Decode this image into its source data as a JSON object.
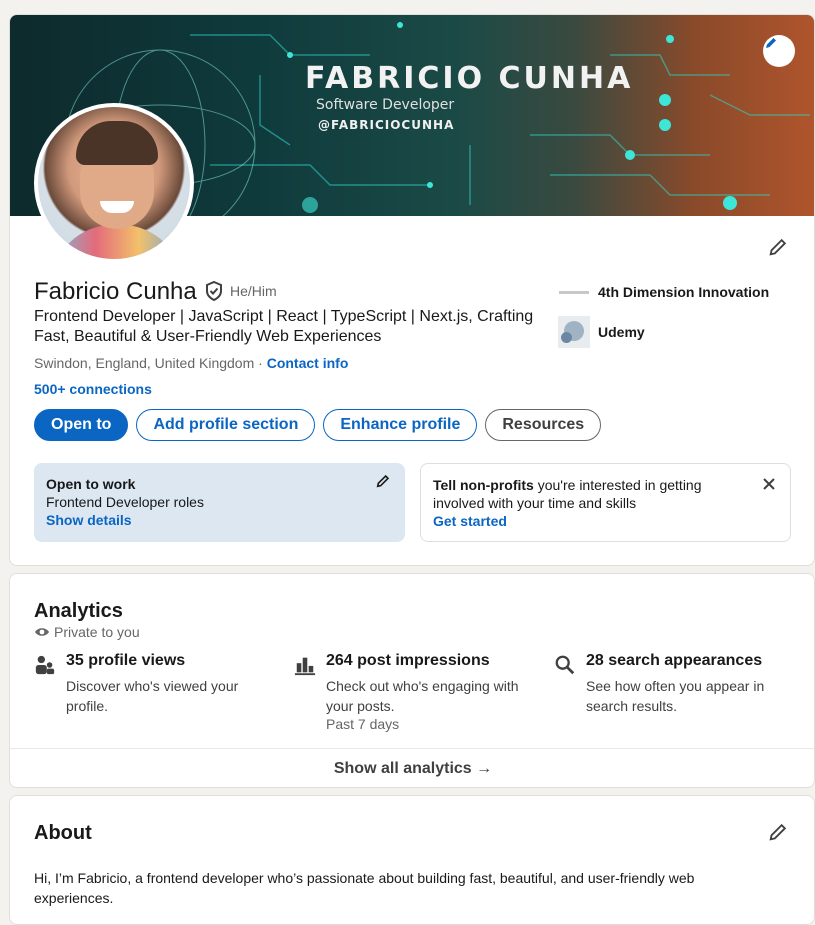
{
  "banner": {
    "title": "FABRICIO CUNHA",
    "subtitle": "Software Developer",
    "handle": "@FABRICIOCUNHA"
  },
  "profile": {
    "name": "Fabricio Cunha",
    "pronouns": "He/Him",
    "headline": "Frontend Developer | JavaScript | React | TypeScript | Next.js, Crafting Fast, Beautiful & User-Friendly Web Experiences",
    "location": "Swindon, England, United Kingdom",
    "separator": " · ",
    "contact_info": "Contact info",
    "connections": "500+ connections",
    "companies": [
      {
        "name": "4th Dimension Innovation"
      },
      {
        "name": "Udemy"
      }
    ]
  },
  "actions": {
    "open_to": "Open to",
    "add_section": "Add profile section",
    "enhance": "Enhance profile",
    "resources": "Resources"
  },
  "open_to_work": {
    "title": "Open to work",
    "roles": "Frontend Developer roles",
    "link": "Show details"
  },
  "non_profits": {
    "bold": "Tell non-profits",
    "text": " you're interested in getting involved with your time and skills",
    "link": "Get started"
  },
  "analytics": {
    "title": "Analytics",
    "private": "Private to you",
    "stats": [
      {
        "icon": "people-icon",
        "head": "35 profile views",
        "desc": "Discover who's viewed your profile."
      },
      {
        "icon": "bar-chart-icon",
        "head": "264 post impressions",
        "desc": "Check out who's engaging with your posts.",
        "period": "Past 7 days"
      },
      {
        "icon": "search-icon",
        "head": "28 search appearances",
        "desc": "See how often you appear in search results."
      }
    ],
    "show_all": "Show all analytics →"
  },
  "about": {
    "title": "About",
    "text": "Hi, I’m Fabricio, a frontend developer who’s passionate about building fast, beautiful, and user-friendly web experiences."
  },
  "colors": {
    "accent": "#0a66c2",
    "open_to_work_bg": "#dde7f1"
  }
}
